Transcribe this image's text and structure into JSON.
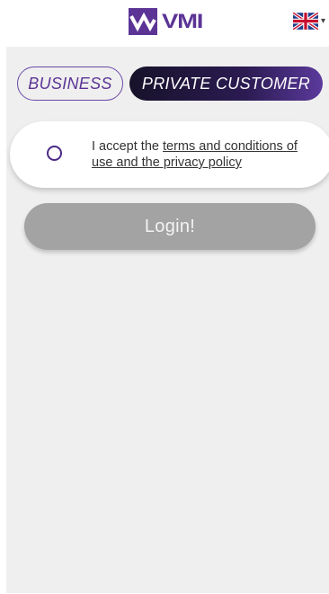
{
  "header": {
    "brand_name": "VMI",
    "language_icon": "uk-flag-icon",
    "language_caret": "▾"
  },
  "customer_type": {
    "options": [
      {
        "label": "BUSINESS",
        "selected": false
      },
      {
        "label": "PRIVATE CUSTOMER",
        "selected": true
      }
    ]
  },
  "terms": {
    "checked": false,
    "prefix": "I accept the ",
    "link_text": "terms and conditions of use and the privacy policy"
  },
  "login": {
    "label": "Login!",
    "enabled": false
  },
  "colors": {
    "brand_purple": "#5b3496",
    "segment_dark": "#17122a",
    "disabled_button": "#a3a3a3",
    "content_background": "#efefef"
  }
}
